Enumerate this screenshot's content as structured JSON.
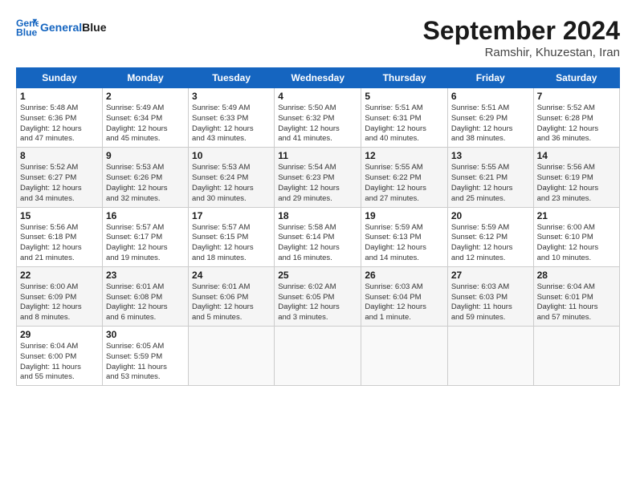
{
  "header": {
    "logo_line1": "General",
    "logo_line2": "Blue",
    "month": "September 2024",
    "location": "Ramshir, Khuzestan, Iran"
  },
  "weekdays": [
    "Sunday",
    "Monday",
    "Tuesday",
    "Wednesday",
    "Thursday",
    "Friday",
    "Saturday"
  ],
  "weeks": [
    [
      {
        "day": "1",
        "info": "Sunrise: 5:48 AM\nSunset: 6:36 PM\nDaylight: 12 hours\nand 47 minutes."
      },
      {
        "day": "2",
        "info": "Sunrise: 5:49 AM\nSunset: 6:34 PM\nDaylight: 12 hours\nand 45 minutes."
      },
      {
        "day": "3",
        "info": "Sunrise: 5:49 AM\nSunset: 6:33 PM\nDaylight: 12 hours\nand 43 minutes."
      },
      {
        "day": "4",
        "info": "Sunrise: 5:50 AM\nSunset: 6:32 PM\nDaylight: 12 hours\nand 41 minutes."
      },
      {
        "day": "5",
        "info": "Sunrise: 5:51 AM\nSunset: 6:31 PM\nDaylight: 12 hours\nand 40 minutes."
      },
      {
        "day": "6",
        "info": "Sunrise: 5:51 AM\nSunset: 6:29 PM\nDaylight: 12 hours\nand 38 minutes."
      },
      {
        "day": "7",
        "info": "Sunrise: 5:52 AM\nSunset: 6:28 PM\nDaylight: 12 hours\nand 36 minutes."
      }
    ],
    [
      {
        "day": "8",
        "info": "Sunrise: 5:52 AM\nSunset: 6:27 PM\nDaylight: 12 hours\nand 34 minutes."
      },
      {
        "day": "9",
        "info": "Sunrise: 5:53 AM\nSunset: 6:26 PM\nDaylight: 12 hours\nand 32 minutes."
      },
      {
        "day": "10",
        "info": "Sunrise: 5:53 AM\nSunset: 6:24 PM\nDaylight: 12 hours\nand 30 minutes."
      },
      {
        "day": "11",
        "info": "Sunrise: 5:54 AM\nSunset: 6:23 PM\nDaylight: 12 hours\nand 29 minutes."
      },
      {
        "day": "12",
        "info": "Sunrise: 5:55 AM\nSunset: 6:22 PM\nDaylight: 12 hours\nand 27 minutes."
      },
      {
        "day": "13",
        "info": "Sunrise: 5:55 AM\nSunset: 6:21 PM\nDaylight: 12 hours\nand 25 minutes."
      },
      {
        "day": "14",
        "info": "Sunrise: 5:56 AM\nSunset: 6:19 PM\nDaylight: 12 hours\nand 23 minutes."
      }
    ],
    [
      {
        "day": "15",
        "info": "Sunrise: 5:56 AM\nSunset: 6:18 PM\nDaylight: 12 hours\nand 21 minutes."
      },
      {
        "day": "16",
        "info": "Sunrise: 5:57 AM\nSunset: 6:17 PM\nDaylight: 12 hours\nand 19 minutes."
      },
      {
        "day": "17",
        "info": "Sunrise: 5:57 AM\nSunset: 6:15 PM\nDaylight: 12 hours\nand 18 minutes."
      },
      {
        "day": "18",
        "info": "Sunrise: 5:58 AM\nSunset: 6:14 PM\nDaylight: 12 hours\nand 16 minutes."
      },
      {
        "day": "19",
        "info": "Sunrise: 5:59 AM\nSunset: 6:13 PM\nDaylight: 12 hours\nand 14 minutes."
      },
      {
        "day": "20",
        "info": "Sunrise: 5:59 AM\nSunset: 6:12 PM\nDaylight: 12 hours\nand 12 minutes."
      },
      {
        "day": "21",
        "info": "Sunrise: 6:00 AM\nSunset: 6:10 PM\nDaylight: 12 hours\nand 10 minutes."
      }
    ],
    [
      {
        "day": "22",
        "info": "Sunrise: 6:00 AM\nSunset: 6:09 PM\nDaylight: 12 hours\nand 8 minutes."
      },
      {
        "day": "23",
        "info": "Sunrise: 6:01 AM\nSunset: 6:08 PM\nDaylight: 12 hours\nand 6 minutes."
      },
      {
        "day": "24",
        "info": "Sunrise: 6:01 AM\nSunset: 6:06 PM\nDaylight: 12 hours\nand 5 minutes."
      },
      {
        "day": "25",
        "info": "Sunrise: 6:02 AM\nSunset: 6:05 PM\nDaylight: 12 hours\nand 3 minutes."
      },
      {
        "day": "26",
        "info": "Sunrise: 6:03 AM\nSunset: 6:04 PM\nDaylight: 12 hours\nand 1 minute."
      },
      {
        "day": "27",
        "info": "Sunrise: 6:03 AM\nSunset: 6:03 PM\nDaylight: 11 hours\nand 59 minutes."
      },
      {
        "day": "28",
        "info": "Sunrise: 6:04 AM\nSunset: 6:01 PM\nDaylight: 11 hours\nand 57 minutes."
      }
    ],
    [
      {
        "day": "29",
        "info": "Sunrise: 6:04 AM\nSunset: 6:00 PM\nDaylight: 11 hours\nand 55 minutes."
      },
      {
        "day": "30",
        "info": "Sunrise: 6:05 AM\nSunset: 5:59 PM\nDaylight: 11 hours\nand 53 minutes."
      },
      {
        "day": "",
        "info": ""
      },
      {
        "day": "",
        "info": ""
      },
      {
        "day": "",
        "info": ""
      },
      {
        "day": "",
        "info": ""
      },
      {
        "day": "",
        "info": ""
      }
    ]
  ]
}
